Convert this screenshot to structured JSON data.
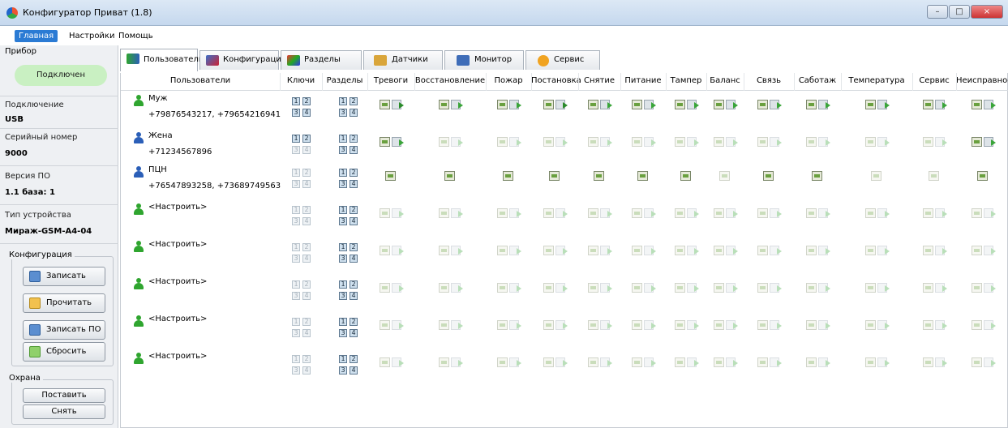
{
  "window": {
    "title": "Конфигуратор Приват (1.8)",
    "buttons": [
      "–",
      "□",
      "×"
    ]
  },
  "menu": [
    {
      "label": "Главная",
      "active": true
    },
    {
      "label": "Настройки",
      "active": false
    },
    {
      "label": "Помощь",
      "active": false
    }
  ],
  "left": {
    "device_group": "Прибор",
    "status": "Подключен",
    "fields": [
      {
        "label": "Подключение",
        "value": "USB"
      },
      {
        "label": "Серийный номер",
        "value": "9000"
      },
      {
        "label": "Версия ПО",
        "value": "1.1 база: 1"
      },
      {
        "label": "Тип устройства",
        "value": "Мираж-GSM-A4-04"
      }
    ],
    "config_group": "Конфигурация",
    "config_buttons": [
      "Записать",
      "Прочитать",
      "Записать ПО",
      "Сбросить"
    ],
    "guard_group": "Охрана",
    "guard_buttons": [
      "Поставить",
      "Снять"
    ]
  },
  "tabs": [
    {
      "label": "Пользователи",
      "icon": "users-icon",
      "selected": true
    },
    {
      "label": "Конфигурация",
      "icon": "tools-icon",
      "selected": false
    },
    {
      "label": "Разделы",
      "icon": "partitions-icon",
      "selected": false
    },
    {
      "label": "Датчики",
      "icon": "sensors-icon",
      "selected": false
    },
    {
      "label": "Монитор",
      "icon": "monitor-icon",
      "selected": false
    },
    {
      "label": "Сервис",
      "icon": "service-icon",
      "selected": false
    }
  ],
  "columns": [
    "Пользователи",
    "Ключи",
    "Разделы",
    "Тревоги",
    "Восстановление",
    "Пожар",
    "Постановка",
    "Снятие",
    "Питание",
    "Тампер",
    "Баланс",
    "Связь",
    "Саботаж",
    "Температура",
    "Сервис",
    "Неисправность"
  ],
  "users": [
    {
      "name": "Муж",
      "phones": "+79876543217, +79654216941",
      "color": "#2fa52f",
      "keys": [
        true,
        true,
        true,
        true
      ],
      "parts": [
        true,
        true,
        true,
        true
      ],
      "events": [
        "on",
        "full",
        "full",
        "on",
        "full",
        "full",
        "full",
        "full",
        "full",
        "full",
        "full",
        "full",
        "full"
      ]
    },
    {
      "name": "Жена",
      "phones": "+71234567896",
      "color": "#2b5fb8",
      "keys": [
        true,
        true,
        false,
        false
      ],
      "parts": [
        true,
        true,
        true,
        true
      ],
      "events": [
        "full",
        "faded",
        "faded",
        "faded",
        "faded",
        "faded",
        "faded",
        "faded",
        "faded",
        "faded",
        "faded",
        "faded",
        "full"
      ]
    },
    {
      "name": "ПЦН",
      "phones": "+76547893258, +73689749563",
      "color": "#2b5fb8",
      "keys": [
        false,
        false,
        false,
        false
      ],
      "parts": [
        true,
        true,
        true,
        true
      ],
      "events": [
        "env",
        "env",
        "env",
        "env",
        "env",
        "env",
        "env",
        "envf",
        "env",
        "env",
        "envf",
        "envf",
        "env"
      ]
    },
    {
      "name": "<Настроить>",
      "phones": "",
      "color": "#2fa52f",
      "keys": [
        false,
        false,
        false,
        false
      ],
      "parts": [
        true,
        true,
        true,
        true
      ],
      "events": [
        "faded",
        "faded",
        "faded",
        "faded",
        "faded",
        "faded",
        "faded",
        "faded",
        "faded",
        "faded",
        "faded",
        "faded",
        "faded"
      ]
    },
    {
      "name": "<Настроить>",
      "phones": "",
      "color": "#2fa52f",
      "keys": [
        false,
        false,
        false,
        false
      ],
      "parts": [
        true,
        true,
        true,
        true
      ],
      "events": [
        "faded",
        "faded",
        "faded",
        "faded",
        "faded",
        "faded",
        "faded",
        "faded",
        "faded",
        "faded",
        "faded",
        "faded",
        "faded"
      ]
    },
    {
      "name": "<Настроить>",
      "phones": "",
      "color": "#2fa52f",
      "keys": [
        false,
        false,
        false,
        false
      ],
      "parts": [
        true,
        true,
        true,
        true
      ],
      "events": [
        "faded",
        "faded",
        "faded",
        "faded",
        "faded",
        "faded",
        "faded",
        "faded",
        "faded",
        "faded",
        "faded",
        "faded",
        "faded"
      ]
    },
    {
      "name": "<Настроить>",
      "phones": "",
      "color": "#2fa52f",
      "keys": [
        false,
        false,
        false,
        false
      ],
      "parts": [
        true,
        true,
        true,
        true
      ],
      "events": [
        "faded",
        "faded",
        "faded",
        "faded",
        "faded",
        "faded",
        "faded",
        "faded",
        "faded",
        "faded",
        "faded",
        "faded",
        "faded"
      ]
    },
    {
      "name": "<Настроить>",
      "phones": "",
      "color": "#2fa52f",
      "keys": [
        false,
        false,
        false,
        false
      ],
      "parts": [
        true,
        true,
        true,
        true
      ],
      "events": [
        "faded",
        "faded",
        "faded",
        "faded",
        "faded",
        "faded",
        "faded",
        "faded",
        "faded",
        "faded",
        "faded",
        "faded",
        "faded"
      ]
    }
  ]
}
